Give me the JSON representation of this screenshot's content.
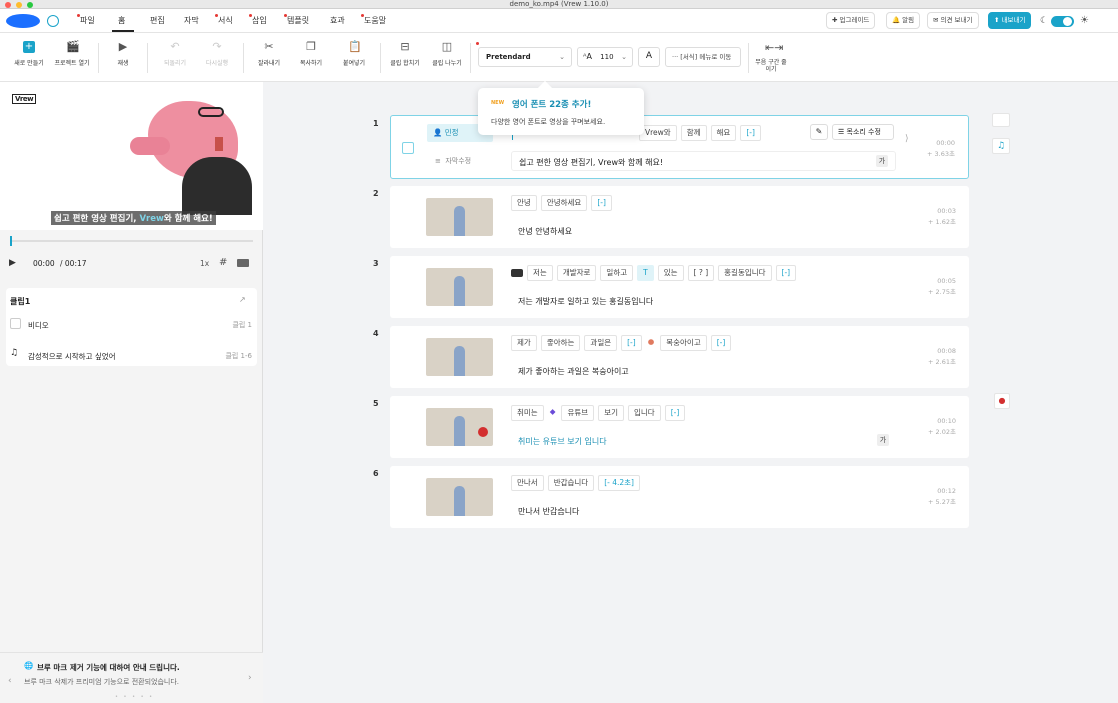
{
  "window": {
    "title": "demo_ko.mp4 (Vrew 1.10.0)"
  },
  "menu": {
    "items": [
      {
        "label": "파일",
        "dot": true
      },
      {
        "label": "홈",
        "dot": false,
        "active": true
      },
      {
        "label": "편집",
        "dot": false
      },
      {
        "label": "자막",
        "dot": false
      },
      {
        "label": "서식",
        "dot": true
      },
      {
        "label": "삽입",
        "dot": true
      },
      {
        "label": "템플릿",
        "dot": true
      },
      {
        "label": "효과",
        "dot": false
      },
      {
        "label": "도움말",
        "dot": true
      }
    ],
    "upgrade": "업그레이드",
    "notify": "알림",
    "feedback": "의견 보내기",
    "export": "내보내기"
  },
  "toolbar": {
    "new_project": "새로 만들기",
    "open_project": "프로젝트 열기",
    "play": "재생",
    "undo": "되돌리기",
    "redo": "다시실행",
    "cut": "잘라내기",
    "copy": "복사하기",
    "paste": "붙여넣기",
    "merge_clip": "클립 합치기",
    "split_clip": "클립 나누기",
    "font": "Pretendard",
    "font_size": "110",
    "format_menu": "[서식] 메뉴로 이동",
    "silence": "무음 구간 줄이기"
  },
  "tooltip": {
    "badge": "NEW",
    "title": "영어 폰트 22종 추가!",
    "desc": "다양한 영어 폰트로 영상을 꾸며보세요."
  },
  "preview": {
    "logo": "Vrew",
    "caption_pre": "쉽고 편한 영상 편집기, ",
    "caption_brand": "Vrew",
    "caption_post": "와 함께 해요!",
    "time_current": "00:00",
    "time_total": "/ 00:17",
    "speed": "1x"
  },
  "clip_panel": {
    "title": "클립1",
    "rows": [
      {
        "label": "비디오",
        "meta": "클립 1"
      },
      {
        "label": "감성적으로 시작하고 싶었어",
        "meta": "클립 1-6"
      }
    ]
  },
  "notice": {
    "title": "브루 마크 제거 기능에 대하여 안내 드립니다.",
    "desc": "브루 마크 삭제가 프리미엄 기능으로 전환되었습니다."
  },
  "clips": [
    {
      "num": "1",
      "speaker": "민정",
      "sub_label": "자막수정",
      "tokens": [
        "Vrew와",
        "함께",
        "해요",
        "[-]"
      ],
      "caption": "쉽고 편한 영상 편집기, Vrew와 함께 해요!",
      "time": "00:00",
      "dur": "+ 3.63초",
      "voice_edit": "목소리 수정"
    },
    {
      "num": "2",
      "tokens": [
        "안녕",
        "안녕하세요",
        "[-]"
      ],
      "caption": "안녕 안녕하세요",
      "time": "00:03",
      "dur": "+ 1.62초"
    },
    {
      "num": "3",
      "tokens": [
        "저는",
        "개발자로",
        "일하고",
        "T",
        "있는",
        "[ ? ]",
        "홍길동입니다",
        "[-]"
      ],
      "caption": "저는 개발자로 일하고 있는 홍길동입니다",
      "time": "00:05",
      "dur": "+ 2.75초"
    },
    {
      "num": "4",
      "tokens": [
        "제가",
        "좋아하는",
        "과일은",
        "[-]",
        "복숭아이고",
        "[-]"
      ],
      "caption": "제가 좋아하는 과일은 복숭아이고",
      "time": "00:08",
      "dur": "+ 2.61초"
    },
    {
      "num": "5",
      "tokens": [
        "취미는",
        "유튜브",
        "보기",
        "입니다",
        "[-]"
      ],
      "caption": "취미는 유튜브 보기 입니다",
      "time": "00:10",
      "dur": "+ 2.02초"
    },
    {
      "num": "6",
      "tokens": [
        "만나서",
        "반갑습니다",
        "[- 4.2초]"
      ],
      "caption": "만나서 반갑습니다",
      "time": "00:12",
      "dur": "+ 5.27초"
    }
  ],
  "colors": {
    "accent": "#1aa3c9",
    "export_bg": "#1aa3c9",
    "selected_border": "#7fd3e6"
  }
}
